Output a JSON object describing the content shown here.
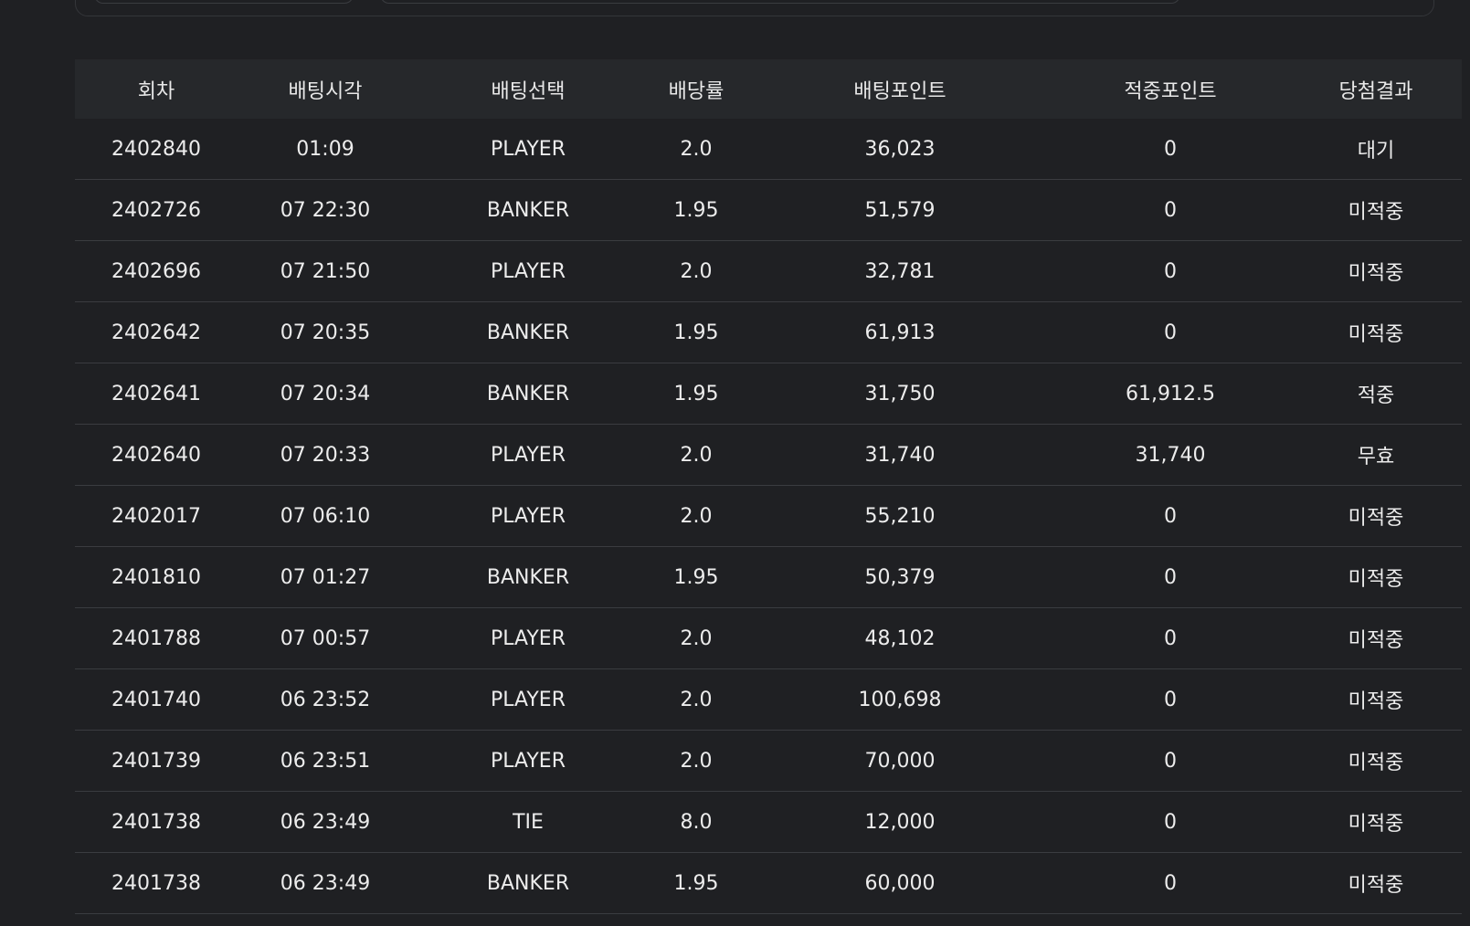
{
  "table": {
    "headers": [
      "회차",
      "배팅시각",
      "배팅선택",
      "배당률",
      "배팅포인트",
      "적중포인트",
      "당첨결과"
    ],
    "rows": [
      [
        "2402840",
        "01:09",
        "PLAYER",
        "2.0",
        "36,023",
        "0",
        "대기"
      ],
      [
        "2402726",
        "07 22:30",
        "BANKER",
        "1.95",
        "51,579",
        "0",
        "미적중"
      ],
      [
        "2402696",
        "07 21:50",
        "PLAYER",
        "2.0",
        "32,781",
        "0",
        "미적중"
      ],
      [
        "2402642",
        "07 20:35",
        "BANKER",
        "1.95",
        "61,913",
        "0",
        "미적중"
      ],
      [
        "2402641",
        "07 20:34",
        "BANKER",
        "1.95",
        "31,750",
        "61,912.5",
        "적중"
      ],
      [
        "2402640",
        "07 20:33",
        "PLAYER",
        "2.0",
        "31,740",
        "31,740",
        "무효"
      ],
      [
        "2402017",
        "07 06:10",
        "PLAYER",
        "2.0",
        "55,210",
        "0",
        "미적중"
      ],
      [
        "2401810",
        "07 01:27",
        "BANKER",
        "1.95",
        "50,379",
        "0",
        "미적중"
      ],
      [
        "2401788",
        "07 00:57",
        "PLAYER",
        "2.0",
        "48,102",
        "0",
        "미적중"
      ],
      [
        "2401740",
        "06 23:52",
        "PLAYER",
        "2.0",
        "100,698",
        "0",
        "미적중"
      ],
      [
        "2401739",
        "06 23:51",
        "PLAYER",
        "2.0",
        "70,000",
        "0",
        "미적중"
      ],
      [
        "2401738",
        "06 23:49",
        "TIE",
        "8.0",
        "12,000",
        "0",
        "미적중"
      ],
      [
        "2401738",
        "06 23:49",
        "BANKER",
        "1.95",
        "60,000",
        "0",
        "미적중"
      ]
    ]
  }
}
